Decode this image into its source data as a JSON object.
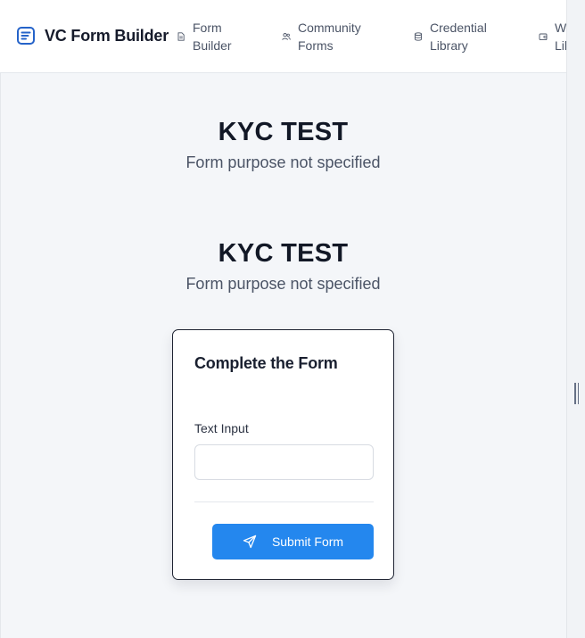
{
  "header": {
    "app_title": "VC Form Builder",
    "nav": [
      {
        "label": "Form Builder",
        "icon": "file-icon"
      },
      {
        "label": "Community Forms",
        "icon": "users-icon"
      },
      {
        "label": "Credential Library",
        "icon": "database-icon"
      },
      {
        "label": "Wallet Library",
        "icon": "wallet-icon"
      }
    ]
  },
  "main": {
    "sections": [
      {
        "title": "KYC TEST",
        "purpose": "Form purpose not specified"
      },
      {
        "title": "KYC TEST",
        "purpose": "Form purpose not specified"
      }
    ],
    "form": {
      "title": "Complete the Form",
      "field_label": "Text Input",
      "field_value": "",
      "field_placeholder": "",
      "submit_label": "Submit Form"
    }
  },
  "colors": {
    "accent": "#2487ee",
    "brand_icon": "#2563c9",
    "background": "#f4f6f9"
  }
}
